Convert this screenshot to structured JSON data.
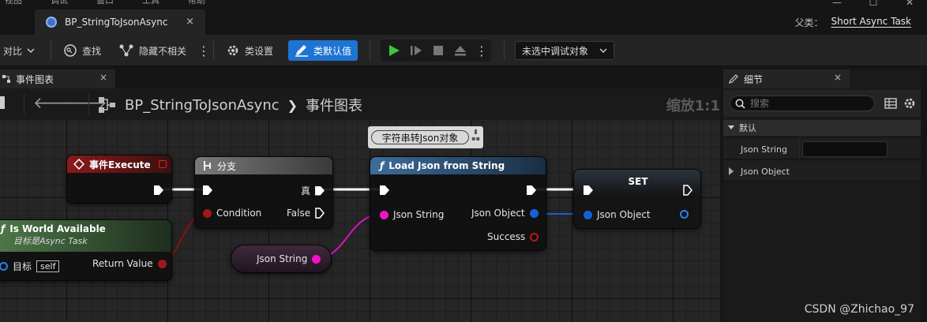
{
  "menu": [
    "视图",
    "调试",
    "窗口",
    "工具",
    "帮助"
  ],
  "window": {
    "minimize": "—",
    "maximize": "☐",
    "close": "✕"
  },
  "document_tab": {
    "label": "BP_StringToJsonAsync",
    "close": "×"
  },
  "parent": {
    "label": "父类：",
    "value": "Short Async Task"
  },
  "toolbar": {
    "diff": "对比",
    "find": "查找",
    "hide_unrelated": "隐藏不相关",
    "class_settings": "类设置",
    "class_defaults": "类默认值",
    "debug_target": "未选中调试对象"
  },
  "graph_tab": {
    "label": "事件图表",
    "close": "×"
  },
  "breadcrumb": {
    "blueprint": "BP_StringToJsonAsync",
    "graph": "事件图表"
  },
  "zoom": "缩放1:1",
  "comment": "字符串转Json对象",
  "nodes": {
    "event_execute": {
      "title": "事件Execute"
    },
    "is_world_available": {
      "title": "Is World Available",
      "subtitle": "目标是Async Task",
      "target_label": "目标",
      "target_value": "self",
      "return_label": "Return Value"
    },
    "branch": {
      "title": "分支",
      "true_label": "真",
      "condition_label": "Condition",
      "false_label": "False"
    },
    "load_json": {
      "title": "Load Json from String",
      "json_string_label": "Json String",
      "json_object_label": "Json Object",
      "success_label": "Success"
    },
    "set": {
      "title": "SET",
      "json_object_label": "Json Object"
    },
    "var_json_string": {
      "label": "Json String"
    }
  },
  "details": {
    "tab_label": "细节",
    "close": "×",
    "search_placeholder": "搜索",
    "category": "默认",
    "props": [
      {
        "name": "Json String",
        "value": ""
      },
      {
        "name": "Json Object"
      }
    ]
  },
  "watermark": "CSDN @Zhichao_97",
  "colors": {
    "accent_blue": "#1e74d4",
    "exec_wire": "#ffffff",
    "string_pin": "#f112c8",
    "bool_pin": "#a01818",
    "object_pin": "#1460d8"
  }
}
